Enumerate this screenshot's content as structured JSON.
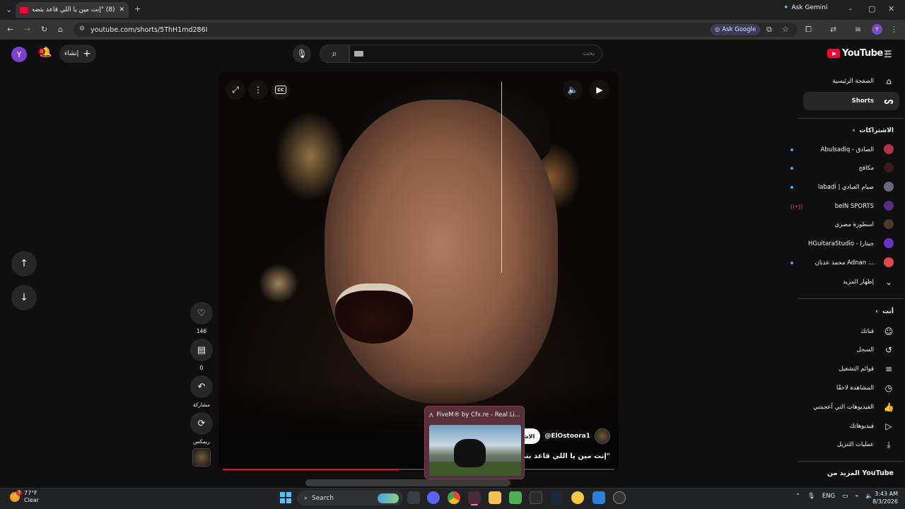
{
  "browser": {
    "tab_title": "(8) \"إنت مين يا اللي قاعد بتضحك\"",
    "url": "youtube.com/shorts/5ThH1md286I",
    "ask_gemini": "Ask Gemini",
    "ask_google": "Ask Google",
    "profile_initial": "Y"
  },
  "header": {
    "avatar_initial": "Y",
    "notification_count": "8",
    "create_label": "إنشاء",
    "search_placeholder": "بحث",
    "logo_text": "YouTube",
    "logo_region": "JO"
  },
  "sidebar": {
    "home": "الصفحة الرئيسية",
    "shorts": "Shorts",
    "subscriptions_title": "الاشتراكات",
    "channels": [
      {
        "name": "Abulsadiq - الصادق",
        "color": "#b4344a",
        "dot": true
      },
      {
        "name": "مكافح",
        "color": "#3a1a1a",
        "dot": true
      },
      {
        "name": "labadi | صيام العبادي",
        "color": "#6a6a7a",
        "dot": true
      },
      {
        "name": "beIN SPORTS",
        "color": "#5b2a86",
        "dot": false,
        "live": true
      },
      {
        "name": "أسطورة مصري",
        "color": "#4a3a2a",
        "dot": false
      },
      {
        "name": "HGuitaraStudio - جيتارا",
        "color": "#6a2fd0",
        "dot": false
      },
      {
        "name": "محمد عدنان Adnan ...",
        "color": "#e04a4a",
        "dot": true
      }
    ],
    "show_more": "إظهار المزيد",
    "you_title": "أنت",
    "you_items": [
      {
        "label": "قناتك",
        "icon": "channel-icon"
      },
      {
        "label": "السجل",
        "icon": "history-icon"
      },
      {
        "label": "قوائم التشغيل",
        "icon": "playlists-icon"
      },
      {
        "label": "المشاهدة لاحقًا",
        "icon": "watch-later-icon"
      },
      {
        "label": "الفيديوهات التي أعجبتني",
        "icon": "liked-icon"
      },
      {
        "label": "فيديوهاتك",
        "icon": "your-videos-icon"
      },
      {
        "label": "عمليات التنزيل",
        "icon": "downloads-icon"
      }
    ],
    "more_from": "المزيد من YouTube"
  },
  "short": {
    "channel_handle": "@ElOstoora1",
    "subscribe_label": "الاشتراك",
    "caption": "\"إنت مين يا اللي قاعد بتضحك ... تس",
    "likes": "146",
    "comments": "0",
    "share_label": "مشاركة",
    "remix_label": "ريمكس",
    "progress": 0.45
  },
  "taskbar_preview": {
    "title": "FiveM® by Cfx.re - Real Li..."
  },
  "taskbar": {
    "weather_temp": "77°F",
    "weather_desc": "Clear",
    "weather_badge": "3",
    "search_label": "Search",
    "lang": "ENG",
    "time": "3:43 AM",
    "date": "8/3/2026"
  }
}
